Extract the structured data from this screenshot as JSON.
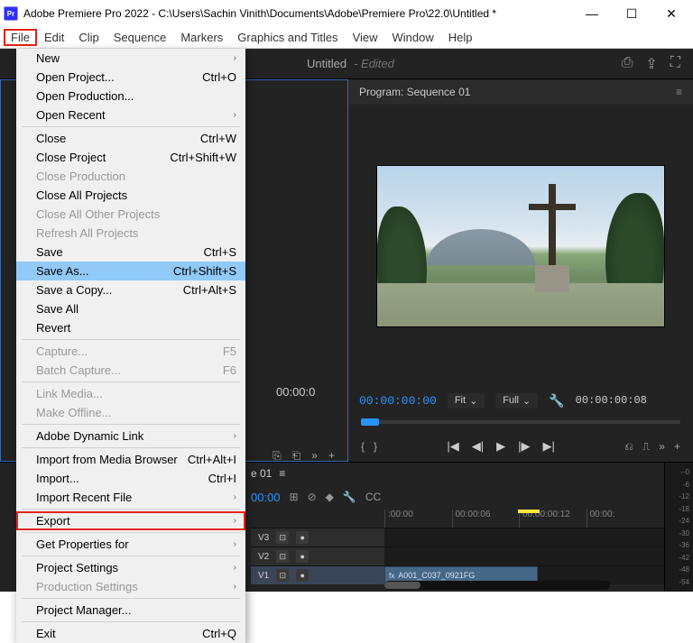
{
  "titlebar": {
    "app_icon": "Pr",
    "title": "Adobe Premiere Pro 2022 - C:\\Users\\Sachin Vinith\\Documents\\Adobe\\Premiere Pro\\22.0\\Untitled *"
  },
  "win_controls": {
    "min": "—",
    "max": "☐",
    "close": "✕"
  },
  "menubar": [
    "File",
    "Edit",
    "Clip",
    "Sequence",
    "Markers",
    "Graphics and Titles",
    "View",
    "Window",
    "Help"
  ],
  "file_menu": {
    "new": {
      "label": "New",
      "sub": "›"
    },
    "open_project": {
      "label": "Open Project...",
      "shortcut": "Ctrl+O"
    },
    "open_production": {
      "label": "Open Production..."
    },
    "open_recent": {
      "label": "Open Recent",
      "sub": "›"
    },
    "close": {
      "label": "Close",
      "shortcut": "Ctrl+W"
    },
    "close_project": {
      "label": "Close Project",
      "shortcut": "Ctrl+Shift+W"
    },
    "close_production": {
      "label": "Close Production"
    },
    "close_all_projects": {
      "label": "Close All Projects"
    },
    "close_all_other": {
      "label": "Close All Other Projects"
    },
    "refresh_all": {
      "label": "Refresh All Projects"
    },
    "save": {
      "label": "Save",
      "shortcut": "Ctrl+S"
    },
    "save_as": {
      "label": "Save As...",
      "shortcut": "Ctrl+Shift+S"
    },
    "save_copy": {
      "label": "Save a Copy...",
      "shortcut": "Ctrl+Alt+S"
    },
    "save_all": {
      "label": "Save All"
    },
    "revert": {
      "label": "Revert"
    },
    "capture": {
      "label": "Capture...",
      "shortcut": "F5"
    },
    "batch_capture": {
      "label": "Batch Capture...",
      "shortcut": "F6"
    },
    "link_media": {
      "label": "Link Media..."
    },
    "make_offline": {
      "label": "Make Offline..."
    },
    "adobe_dynamic": {
      "label": "Adobe Dynamic Link",
      "sub": "›"
    },
    "import_media_browser": {
      "label": "Import from Media Browser",
      "shortcut": "Ctrl+Alt+I"
    },
    "import": {
      "label": "Import...",
      "shortcut": "Ctrl+I"
    },
    "import_recent": {
      "label": "Import Recent File",
      "sub": "›"
    },
    "export": {
      "label": "Export",
      "sub": "›"
    },
    "get_properties": {
      "label": "Get Properties for",
      "sub": "›"
    },
    "project_settings": {
      "label": "Project Settings",
      "sub": "›"
    },
    "production_settings": {
      "label": "Production Settings",
      "sub": "›"
    },
    "project_manager": {
      "label": "Project Manager..."
    },
    "exit": {
      "label": "Exit",
      "shortcut": "Ctrl+Q"
    }
  },
  "workspace": {
    "tab": "Untitled",
    "status": "- Edited"
  },
  "program": {
    "title": "Program: Sequence 01",
    "timecode": "00:00:00:00",
    "fit": "Fit",
    "quality": "Full",
    "duration": "00:00:00:08"
  },
  "source": {
    "timecode": "00:00:0"
  },
  "sequence": {
    "tab": "e 01",
    "hamb": "≡",
    "timecode": "00:00",
    "ruler": [
      ":00:00",
      "00:00:06",
      "00:00:00:12",
      "00:00:"
    ],
    "tracks": {
      "v3": "V3",
      "v2": "V2",
      "v1": "V1"
    },
    "clip_name": "A001_C037_0921FG"
  },
  "icons": {
    "hamb": "≡",
    "chev": "⌄",
    "wrench": "🔧",
    "plus": "+",
    "skip": "»",
    "mark_in": "{",
    "mark_out": "}",
    "step_b": "◀|",
    "play": "▶",
    "step_f": "|▶",
    "ins": "⎘",
    "ovr": "⎗",
    "exp": "⤢",
    "snap": "⊞",
    "link": "⊘",
    "marker": "◆",
    "cc": "CC",
    "eye": "👁",
    "lock": "🔒",
    "fx": "fx",
    "full": "⛶",
    "quick": "⎙"
  },
  "meters": [
    "--0",
    "-6",
    "-12",
    "-18",
    "-24",
    "-30",
    "-36",
    "-42",
    "-48",
    "-54"
  ]
}
